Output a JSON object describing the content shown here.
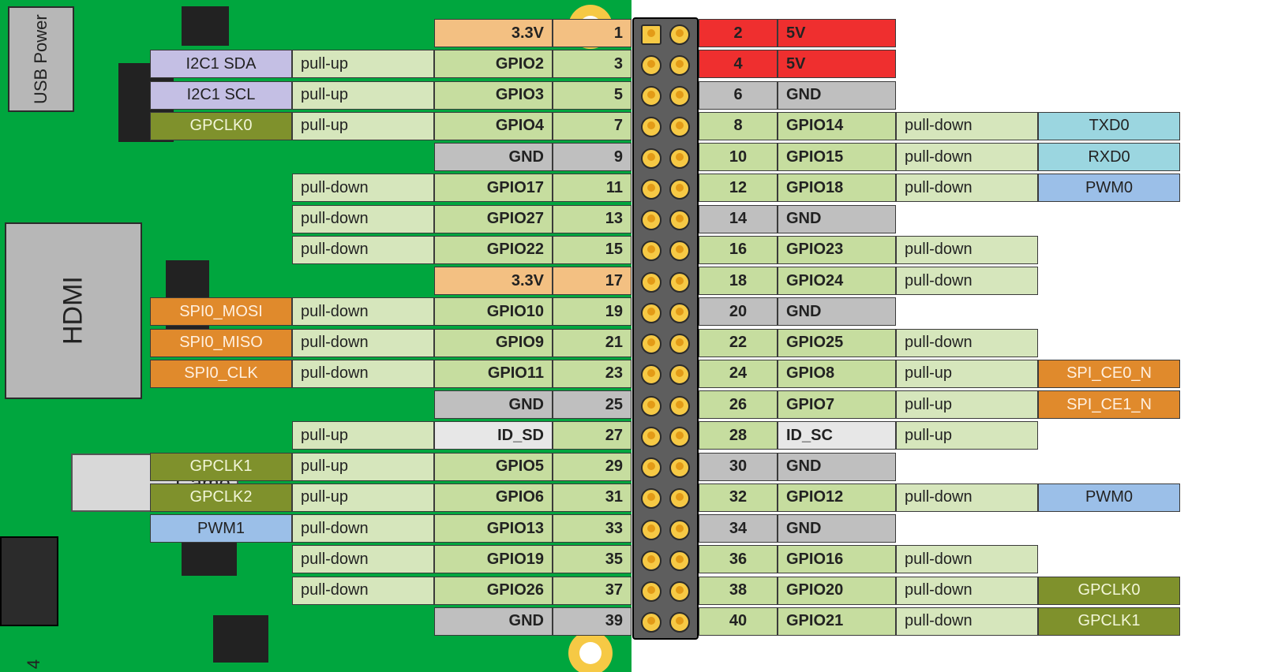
{
  "board": {
    "usb_label": "USB Power",
    "hdmi_label": "HDMI",
    "camera_label": "Came",
    "page_num": "4"
  },
  "colors": {
    "3v3": "c-3v3",
    "5v": "c-5v",
    "gnd": "c-gnd",
    "gpio": "c-gpio",
    "pull": "c-pull",
    "id": "c-id",
    "spi": "c-spi",
    "i2c": "c-i2c",
    "clk": "c-clk",
    "pwm": "c-pwm",
    "uart": "c-uart"
  },
  "left": [
    {
      "num": "1",
      "name": "3.3V",
      "nameCls": "c-3v3",
      "numCls": "c-3v3"
    },
    {
      "num": "3",
      "name": "GPIO2",
      "nameCls": "c-gpio",
      "numCls": "c-gpio",
      "pull": "pull-up",
      "alt": "I2C1 SDA",
      "altCls": "c-i2c"
    },
    {
      "num": "5",
      "name": "GPIO3",
      "nameCls": "c-gpio",
      "numCls": "c-gpio",
      "pull": "pull-up",
      "alt": "I2C1 SCL",
      "altCls": "c-i2c"
    },
    {
      "num": "7",
      "name": "GPIO4",
      "nameCls": "c-gpio",
      "numCls": "c-gpio",
      "pull": "pull-up",
      "alt": "GPCLK0",
      "altCls": "c-clk"
    },
    {
      "num": "9",
      "name": "GND",
      "nameCls": "c-gnd",
      "numCls": "c-gnd"
    },
    {
      "num": "11",
      "name": "GPIO17",
      "nameCls": "c-gpio",
      "numCls": "c-gpio",
      "pull": "pull-down"
    },
    {
      "num": "13",
      "name": "GPIO27",
      "nameCls": "c-gpio",
      "numCls": "c-gpio",
      "pull": "pull-down"
    },
    {
      "num": "15",
      "name": "GPIO22",
      "nameCls": "c-gpio",
      "numCls": "c-gpio",
      "pull": "pull-down"
    },
    {
      "num": "17",
      "name": "3.3V",
      "nameCls": "c-3v3",
      "numCls": "c-3v3"
    },
    {
      "num": "19",
      "name": "GPIO10",
      "nameCls": "c-gpio",
      "numCls": "c-gpio",
      "pull": "pull-down",
      "alt": "SPI0_MOSI",
      "altCls": "c-spi"
    },
    {
      "num": "21",
      "name": "GPIO9",
      "nameCls": "c-gpio",
      "numCls": "c-gpio",
      "pull": "pull-down",
      "alt": "SPI0_MISO",
      "altCls": "c-spi"
    },
    {
      "num": "23",
      "name": "GPIO11",
      "nameCls": "c-gpio",
      "numCls": "c-gpio",
      "pull": "pull-down",
      "alt": "SPI0_CLK",
      "altCls": "c-spi"
    },
    {
      "num": "25",
      "name": "GND",
      "nameCls": "c-gnd",
      "numCls": "c-gnd"
    },
    {
      "num": "27",
      "name": "ID_SD",
      "nameCls": "c-id",
      "numCls": "c-gpio",
      "pull": "pull-up"
    },
    {
      "num": "29",
      "name": "GPIO5",
      "nameCls": "c-gpio",
      "numCls": "c-gpio",
      "pull": "pull-up",
      "alt": "GPCLK1",
      "altCls": "c-clk"
    },
    {
      "num": "31",
      "name": "GPIO6",
      "nameCls": "c-gpio",
      "numCls": "c-gpio",
      "pull": "pull-up",
      "alt": "GPCLK2",
      "altCls": "c-clk"
    },
    {
      "num": "33",
      "name": "GPIO13",
      "nameCls": "c-gpio",
      "numCls": "c-gpio",
      "pull": "pull-down",
      "alt": "PWM1",
      "altCls": "c-pwm"
    },
    {
      "num": "35",
      "name": "GPIO19",
      "nameCls": "c-gpio",
      "numCls": "c-gpio",
      "pull": "pull-down"
    },
    {
      "num": "37",
      "name": "GPIO26",
      "nameCls": "c-gpio",
      "numCls": "c-gpio",
      "pull": "pull-down"
    },
    {
      "num": "39",
      "name": "GND",
      "nameCls": "c-gnd",
      "numCls": "c-gnd"
    }
  ],
  "right": [
    {
      "num": "2",
      "name": "5V",
      "nameCls": "c-5v",
      "numCls": "c-5v"
    },
    {
      "num": "4",
      "name": "5V",
      "nameCls": "c-5v",
      "numCls": "c-5v"
    },
    {
      "num": "6",
      "name": "GND",
      "nameCls": "c-gnd",
      "numCls": "c-gnd"
    },
    {
      "num": "8",
      "name": "GPIO14",
      "nameCls": "c-gpio",
      "numCls": "c-gpio",
      "pull": "pull-down",
      "alt": "TXD0",
      "altCls": "c-uart"
    },
    {
      "num": "10",
      "name": "GPIO15",
      "nameCls": "c-gpio",
      "numCls": "c-gpio",
      "pull": "pull-down",
      "alt": "RXD0",
      "altCls": "c-uart"
    },
    {
      "num": "12",
      "name": "GPIO18",
      "nameCls": "c-gpio",
      "numCls": "c-gpio",
      "pull": "pull-down",
      "alt": "PWM0",
      "altCls": "c-pwm"
    },
    {
      "num": "14",
      "name": "GND",
      "nameCls": "c-gnd",
      "numCls": "c-gnd"
    },
    {
      "num": "16",
      "name": "GPIO23",
      "nameCls": "c-gpio",
      "numCls": "c-gpio",
      "pull": "pull-down"
    },
    {
      "num": "18",
      "name": "GPIO24",
      "nameCls": "c-gpio",
      "numCls": "c-gpio",
      "pull": "pull-down"
    },
    {
      "num": "20",
      "name": "GND",
      "nameCls": "c-gnd",
      "numCls": "c-gnd"
    },
    {
      "num": "22",
      "name": "GPIO25",
      "nameCls": "c-gpio",
      "numCls": "c-gpio",
      "pull": "pull-down"
    },
    {
      "num": "24",
      "name": "GPIO8",
      "nameCls": "c-gpio",
      "numCls": "c-gpio",
      "pull": "pull-up",
      "alt": "SPI_CE0_N",
      "altCls": "c-spi"
    },
    {
      "num": "26",
      "name": "GPIO7",
      "nameCls": "c-gpio",
      "numCls": "c-gpio",
      "pull": "pull-up",
      "alt": "SPI_CE1_N",
      "altCls": "c-spi"
    },
    {
      "num": "28",
      "name": "ID_SC",
      "nameCls": "c-id",
      "numCls": "c-gpio",
      "pull": "pull-up"
    },
    {
      "num": "30",
      "name": "GND",
      "nameCls": "c-gnd",
      "numCls": "c-gnd"
    },
    {
      "num": "32",
      "name": "GPIO12",
      "nameCls": "c-gpio",
      "numCls": "c-gpio",
      "pull": "pull-down",
      "alt": "PWM0",
      "altCls": "c-pwm"
    },
    {
      "num": "34",
      "name": "GND",
      "nameCls": "c-gnd",
      "numCls": "c-gnd"
    },
    {
      "num": "36",
      "name": "GPIO16",
      "nameCls": "c-gpio",
      "numCls": "c-gpio",
      "pull": "pull-down"
    },
    {
      "num": "38",
      "name": "GPIO20",
      "nameCls": "c-gpio",
      "numCls": "c-gpio",
      "pull": "pull-down",
      "alt": "GPCLK0",
      "altCls": "c-clk"
    },
    {
      "num": "40",
      "name": "GPIO21",
      "nameCls": "c-gpio",
      "numCls": "c-gpio",
      "pull": "pull-down",
      "alt": "GPCLK1",
      "altCls": "c-clk"
    }
  ]
}
